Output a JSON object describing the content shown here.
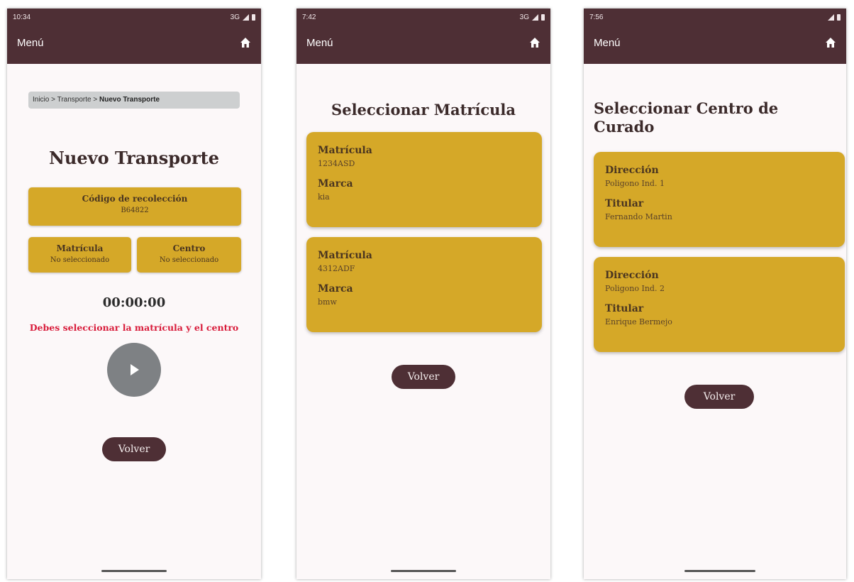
{
  "screen1": {
    "status_time": "10:34",
    "status_net": "3G",
    "menu_label": "Menú",
    "breadcrumb": {
      "part1": "Inicio",
      "sep": ">",
      "part2": "Transporte",
      "current": "Nuevo Transporte"
    },
    "title": "Nuevo Transporte",
    "code_label": "Código de recolección",
    "code_value": "B64822",
    "matricula_label": "Matrícula",
    "matricula_value": "No seleccionado",
    "centro_label": "Centro",
    "centro_value": "No seleccionado",
    "timer": "00:00:00",
    "warning": "Debes seleccionar la matrícula y el centro",
    "back_label": "Volver"
  },
  "screen2": {
    "status_time": "7:42",
    "status_net": "3G",
    "menu_label": "Menú",
    "title": "Seleccionar Matrícula",
    "cards": [
      {
        "k1": "Matrícula",
        "v1": "1234ASD",
        "k2": "Marca",
        "v2": "kia"
      },
      {
        "k1": "Matrícula",
        "v1": "4312ADF",
        "k2": "Marca",
        "v2": "bmw"
      }
    ],
    "back_label": "Volver"
  },
  "screen3": {
    "status_time": "7:56",
    "menu_label": "Menú",
    "title": "Seleccionar Centro de Curado",
    "cards": [
      {
        "k1": "Dirección",
        "v1": "Poligono Ind. 1",
        "k2": "Titular",
        "v2": "Fernando Martin"
      },
      {
        "k1": "Dirección",
        "v1": "Poligono Ind. 2",
        "k2": "Titular",
        "v2": "Enrique Bermejo"
      }
    ],
    "back_label": "Volver"
  },
  "colors": {
    "appbar": "#4e2f35",
    "card": "#d5a828",
    "warning": "#d81b3a",
    "play": "#7e8184"
  },
  "icons": [
    "home-icon",
    "play-icon",
    "signal-icon",
    "battery-icon"
  ]
}
